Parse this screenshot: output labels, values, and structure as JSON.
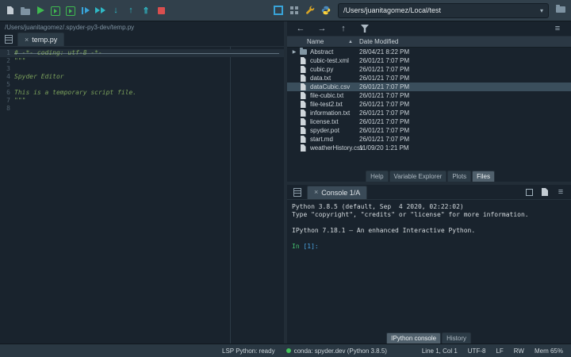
{
  "toolbar": {
    "path_value": "/Users/juanitagomez/Local/test",
    "dropdown_caret": "▾",
    "left_icons": [
      {
        "name": "new-file-icon",
        "kind": "file"
      },
      {
        "name": "open-file-icon",
        "kind": "folder"
      },
      {
        "name": "run-file-icon",
        "kind": "play"
      },
      {
        "name": "run-cell-icon",
        "kind": "boxplay"
      },
      {
        "name": "run-cell-advance-icon",
        "kind": "boxplayadv"
      },
      {
        "name": "debug-file-icon",
        "kind": "debugplay"
      },
      {
        "name": "continue-execution-icon",
        "kind": "dblplay"
      },
      {
        "name": "step-into-icon",
        "kind": "arrow",
        "glyph": "↓"
      },
      {
        "name": "step-out-icon",
        "kind": "arrow",
        "glyph": "↑"
      },
      {
        "name": "step-return-icon",
        "kind": "arrow",
        "glyph": "⇑"
      },
      {
        "name": "stop-debug-icon",
        "kind": "stop"
      }
    ],
    "right_icons": [
      {
        "name": "maximize-pane-icon",
        "kind": "maximize"
      },
      {
        "name": "panes-layout-icon",
        "kind": "grid"
      },
      {
        "name": "preferences-wrench-icon",
        "kind": "wrench"
      },
      {
        "name": "python-environment-icon",
        "kind": "python"
      }
    ],
    "end_icon": {
      "name": "browse-working-directory-icon",
      "kind": "folder"
    }
  },
  "editor": {
    "breadcrumb": "/Users/juanitagomez/.spyder-py3-dev/temp.py",
    "tab_label": "temp.py",
    "close_glyph": "×",
    "current_line": 1,
    "lines": [
      "# -*- coding: utf-8 -*-",
      "\"\"\"",
      "",
      "Spyder Editor",
      "",
      "This is a temporary script file.",
      "\"\"\"",
      ""
    ]
  },
  "files": {
    "nav_icons": [
      {
        "name": "back-icon",
        "kind": "nav",
        "glyph": "←"
      },
      {
        "name": "forward-icon",
        "kind": "nav",
        "glyph": "→"
      },
      {
        "name": "parent-directory-icon",
        "kind": "nav",
        "glyph": "↑"
      },
      {
        "name": "filter-icon",
        "kind": "funnel"
      },
      {
        "name": "files-options-menu-icon",
        "kind": "menu",
        "glyph": "≡"
      }
    ],
    "columns": {
      "name": "Name",
      "sort_glyph": "▲",
      "date": "Date Modified"
    },
    "rows": [
      {
        "name": "Abstract",
        "date": "28/04/21 8:22 PM",
        "type": "folder",
        "expandable": true
      },
      {
        "name": "cubic-test.xml",
        "date": "26/01/21 7:07 PM",
        "type": "file"
      },
      {
        "name": "cubic.py",
        "date": "26/01/21 7:07 PM",
        "type": "file"
      },
      {
        "name": "data.txt",
        "date": "26/01/21 7:07 PM",
        "type": "file"
      },
      {
        "name": "dataCubic.csv",
        "date": "26/01/21 7:07 PM",
        "type": "file",
        "selected": true
      },
      {
        "name": "file-cubic.txt",
        "date": "26/01/21 7:07 PM",
        "type": "file"
      },
      {
        "name": "file-test2.txt",
        "date": "26/01/21 7:07 PM",
        "type": "file"
      },
      {
        "name": "information.txt",
        "date": "26/01/21 7:07 PM",
        "type": "file"
      },
      {
        "name": "license.txt",
        "date": "26/01/21 7:07 PM",
        "type": "file"
      },
      {
        "name": "spyder.pot",
        "date": "26/01/21 7:07 PM",
        "type": "file"
      },
      {
        "name": "start.md",
        "date": "26/01/21 7:07 PM",
        "type": "file"
      },
      {
        "name": "weatherHistory.csv",
        "date": "11/09/20 1:21 PM",
        "type": "file"
      }
    ],
    "tabs": {
      "items": [
        "Help",
        "Variable Explorer",
        "Plots",
        "Files"
      ],
      "active": 3
    }
  },
  "console": {
    "tab_label": "Console 1/A",
    "close_glyph": "×",
    "banner": [
      "Python 3.8.5 (default, Sep  4 2020, 02:22:02)",
      "Type \"copyright\", \"credits\" or \"license\" for more information.",
      "",
      "IPython 7.18.1 — An enhanced Interactive Python.",
      ""
    ],
    "prompt": {
      "in": "In",
      "rest": " [1]:"
    },
    "right_icons": [
      {
        "name": "interrupt-kernel-icon",
        "kind": "stopgray"
      },
      {
        "name": "new-console-icon",
        "kind": "file"
      },
      {
        "name": "console-options-menu-icon",
        "kind": "menu",
        "glyph": "≡"
      }
    ],
    "tabs": {
      "items": [
        "IPython console",
        "History"
      ],
      "active": 0
    }
  },
  "statusbar": {
    "lsp": "LSP Python: ready",
    "conda": "conda: spyder.dev (Python 3.8.5)",
    "status_dot_color": "#43c25b",
    "right": [
      "Line 1, Col 1",
      "UTF-8",
      "LF",
      "RW",
      "Mem 65%"
    ]
  },
  "colors": {
    "background": "#19232d",
    "toolbar": "#31404b",
    "selection": "#3a4e5c",
    "accent": "#148cd2",
    "code_comment_green": "#7ba05b"
  }
}
